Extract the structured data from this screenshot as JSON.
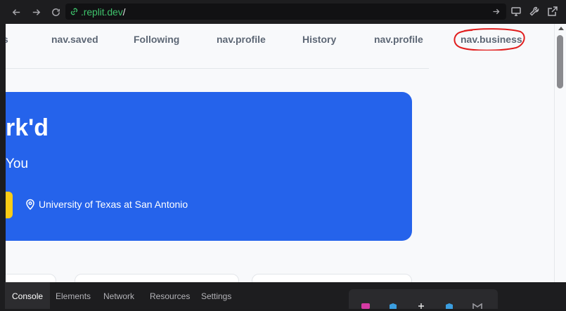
{
  "browser": {
    "url_host": ".replit.dev",
    "url_path": "/"
  },
  "nav": {
    "items": [
      "ls",
      "nav.saved",
      "Following",
      "nav.profile",
      "History",
      "nav.profile"
    ],
    "highlighted_item": "nav.business",
    "highlight_color": "#e11d1d"
  },
  "hero": {
    "title": "rk'd",
    "subtitle": "You",
    "location": "University of Texas at San Antonio",
    "accent_color": "#2563eb",
    "button_color": "#facc15"
  },
  "devtools": {
    "tabs": [
      "Console",
      "Elements",
      "Network",
      "Resources",
      "Settings"
    ],
    "active_tab": "Console"
  }
}
